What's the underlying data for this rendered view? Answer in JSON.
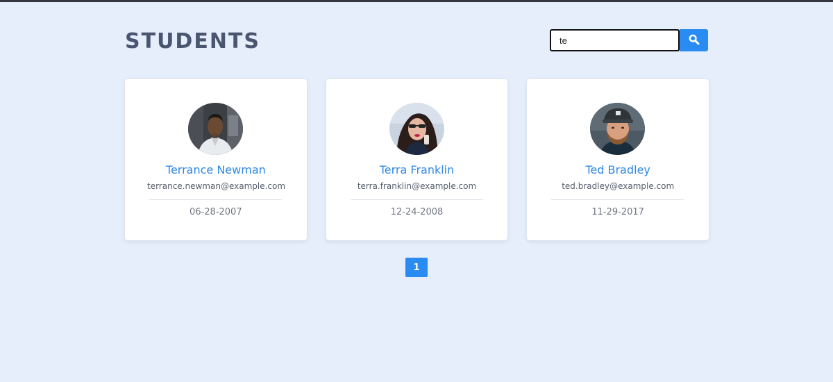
{
  "page": {
    "title": "STUDENTS"
  },
  "search": {
    "value": "te",
    "button_icon": "search-icon"
  },
  "students": [
    {
      "name": "Terrance Newman",
      "email": "terrance.newman@example.com",
      "date": "06-28-2007",
      "avatar": "avatar-photo"
    },
    {
      "name": "Terra Franklin",
      "email": "terra.franklin@example.com",
      "date": "12-24-2008",
      "avatar": "avatar-photo"
    },
    {
      "name": "Ted Bradley",
      "email": "ted.bradley@example.com",
      "date": "11-29-2017",
      "avatar": "avatar-photo"
    }
  ],
  "pagination": {
    "pages": [
      "1"
    ],
    "current": "1"
  },
  "colors": {
    "background": "#e5eefa",
    "accent": "#2a8cf2",
    "title": "#4a5570",
    "name": "#2d88e8"
  }
}
